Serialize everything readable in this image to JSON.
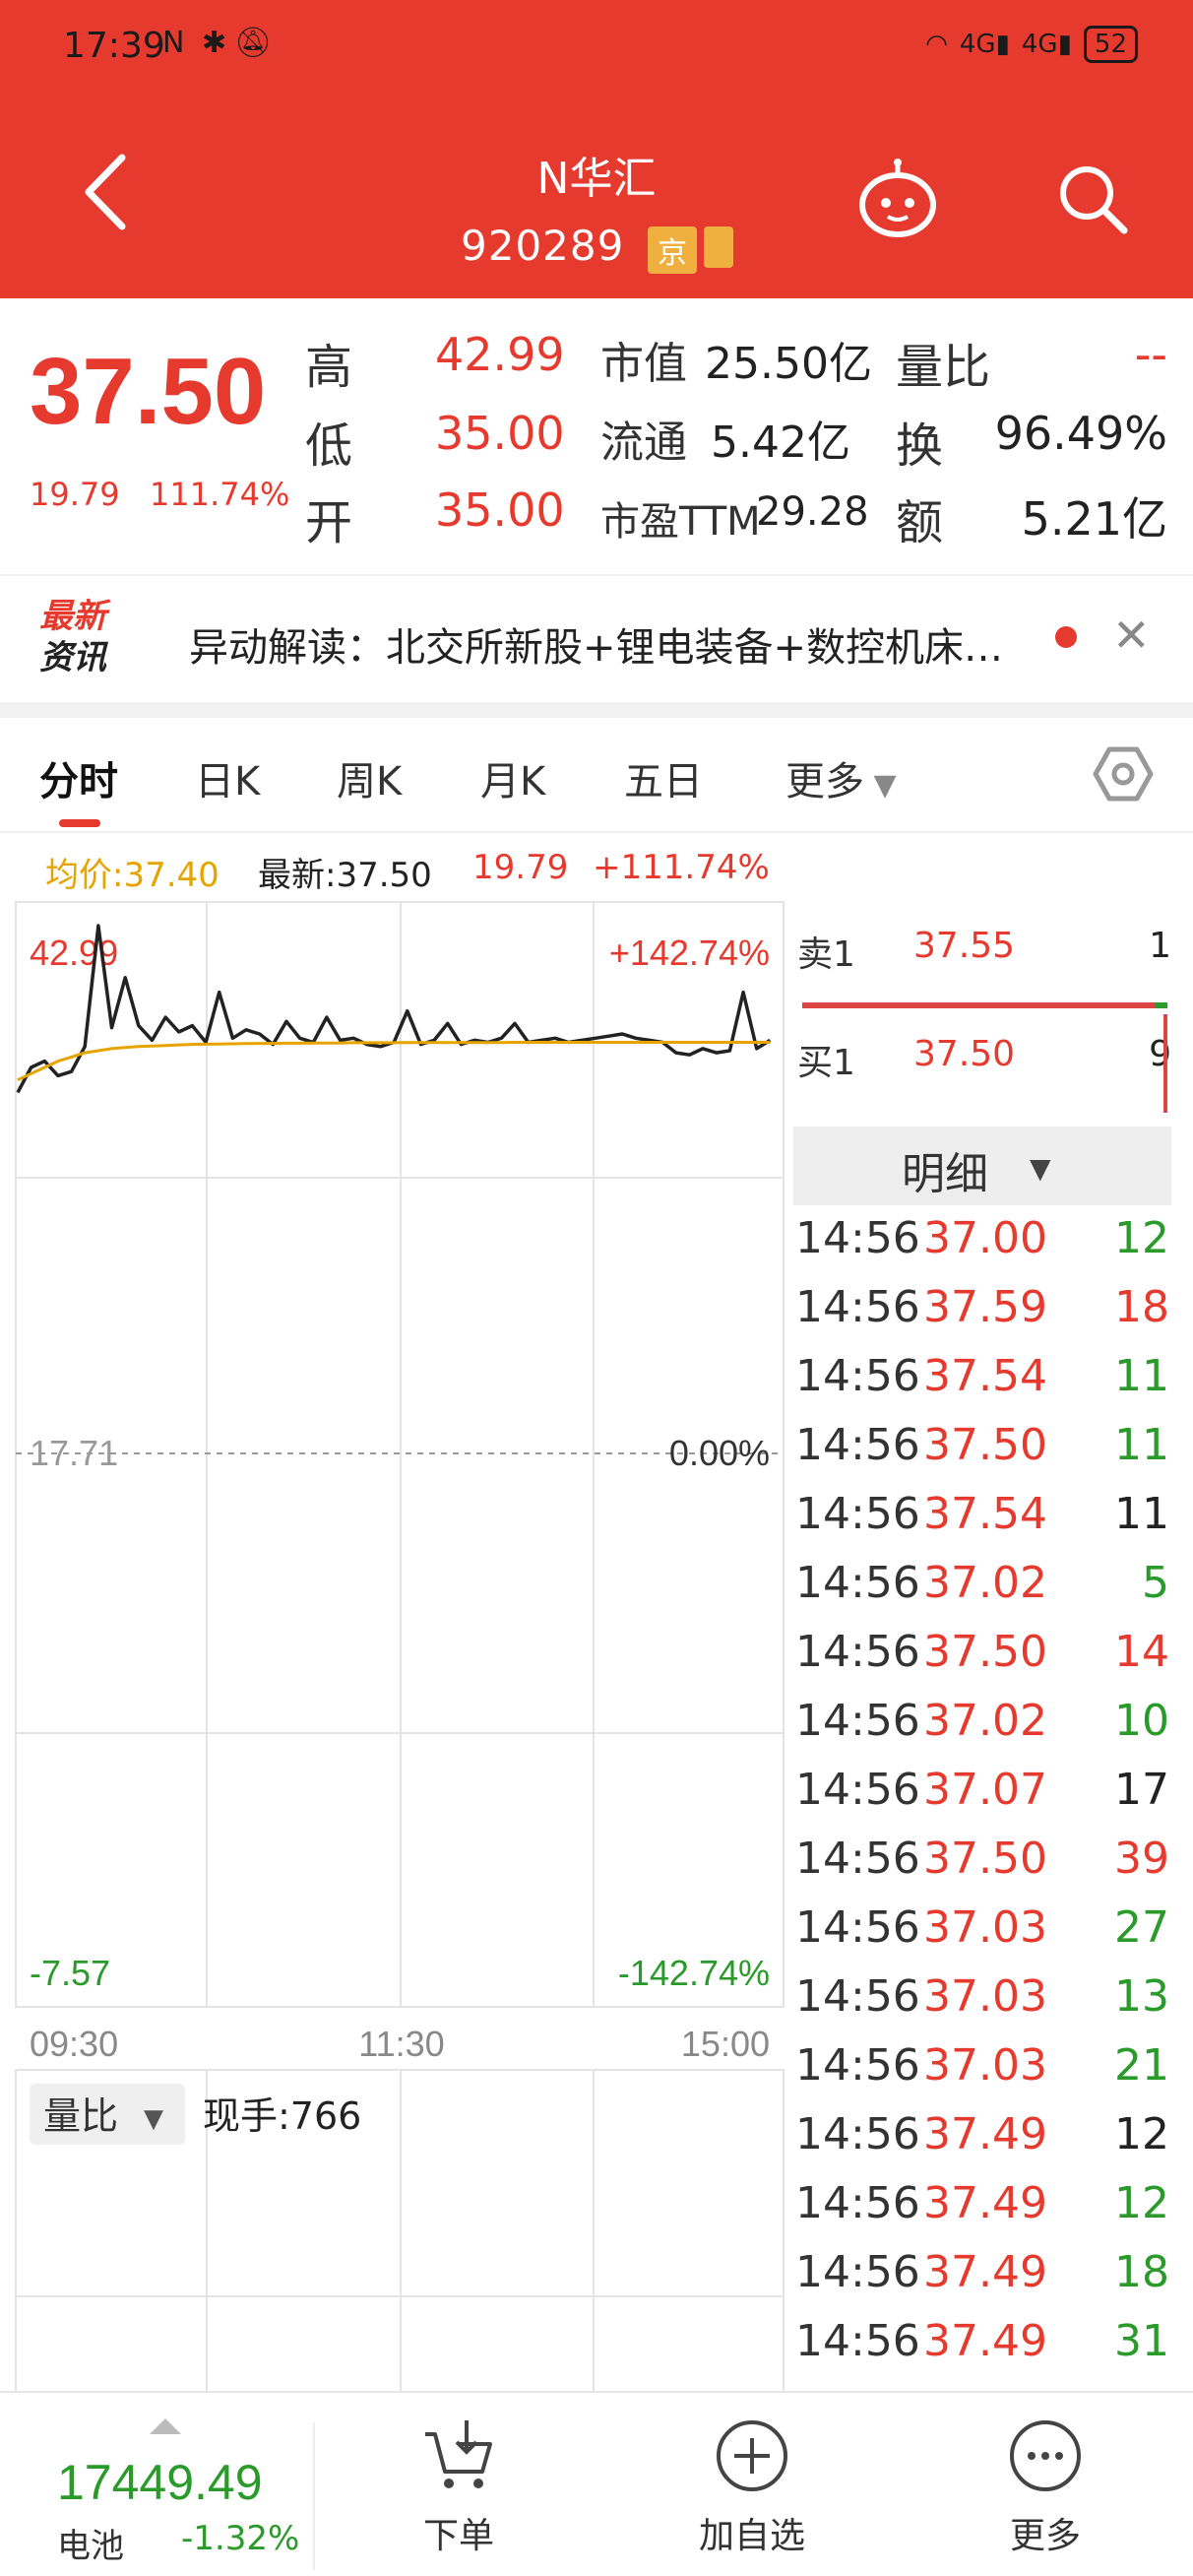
{
  "status_bar": {
    "time": "17:39",
    "network": "4G",
    "network2": "4G",
    "battery": "52"
  },
  "header": {
    "stock_name": "N华汇",
    "stock_code": "920289",
    "market_tag": "京"
  },
  "quote": {
    "price": "37.50",
    "change_abs": "19.79",
    "change_pct": "111.74%",
    "high_label": "高",
    "high": "42.99",
    "low_label": "低",
    "low": "35.00",
    "open_label": "开",
    "open": "35.00",
    "mcap_label": "市值",
    "mcap": "25.50亿",
    "float_label": "流通",
    "float": "5.42亿",
    "pe_label": "市盈TTM",
    "pe": "29.28",
    "vr_label": "量比",
    "vr": "--",
    "turn_label": "换",
    "turn": "96.49%",
    "amt_label": "额",
    "amt": "5.21亿"
  },
  "news": {
    "logo_line1": "最新",
    "logo_line2": "资讯",
    "text": "异动解读：北交所新股+锂电装备+数控机床…"
  },
  "tabs": [
    "分时",
    "日K",
    "周K",
    "月K",
    "五日",
    "更多"
  ],
  "chart_info": {
    "avg_label": "均价:37.40",
    "latest_label": "最新:37.50",
    "chg_abs": "19.79",
    "chg_pct": "+111.74%"
  },
  "chart_data": {
    "type": "line",
    "y_left_ticks": [
      "42.99",
      "17.71",
      "-7.57"
    ],
    "y_right_ticks": [
      "+142.74%",
      "0.00%",
      "-142.74%"
    ],
    "x_ticks": [
      "09:30",
      "11:30",
      "15:00"
    ],
    "series": [
      {
        "name": "最新",
        "color": "#222222",
        "values": [
          35.0,
          36.2,
          36.5,
          35.8,
          36.0,
          37.2,
          42.99,
          38.1,
          40.5,
          38.2,
          37.5,
          38.6,
          37.9,
          38.2,
          37.4,
          39.8,
          37.6,
          38.0,
          37.8,
          37.3,
          38.4,
          37.6,
          37.4,
          38.6,
          37.5,
          37.6,
          37.3,
          37.2,
          37.4,
          38.9,
          37.3,
          37.5,
          38.3,
          37.3,
          37.5,
          37.4,
          37.6,
          38.3,
          37.4,
          37.5,
          37.6,
          37.4,
          37.5,
          37.6,
          37.7,
          37.8,
          37.6,
          37.5,
          37.4,
          36.9,
          36.8,
          37.1,
          36.9,
          37.0,
          39.8,
          37.1,
          37.5
        ]
      },
      {
        "name": "均价",
        "color": "#e6a400",
        "values": [
          35.6,
          35.9,
          36.2,
          36.5,
          36.7,
          36.9,
          37.0,
          37.1,
          37.15,
          37.2,
          37.22,
          37.25,
          37.28,
          37.3,
          37.31,
          37.32,
          37.33,
          37.34,
          37.35,
          37.35,
          37.36,
          37.36,
          37.37,
          37.37,
          37.37,
          37.38,
          37.38,
          37.38,
          37.38,
          37.39,
          37.39,
          37.39,
          37.39,
          37.39,
          37.39,
          37.39,
          37.39,
          37.4,
          37.4,
          37.4,
          37.4,
          37.4,
          37.4,
          37.4,
          37.4,
          37.4,
          37.4,
          37.4,
          37.4,
          37.4,
          37.4,
          37.4,
          37.4,
          37.4,
          37.4,
          37.4,
          37.4
        ]
      }
    ],
    "ylim": [
      -7.57,
      42.99
    ]
  },
  "volume_panel": {
    "selector_label": "量比",
    "current_vol_label": "现手:766"
  },
  "orderbook": {
    "sell1_label": "卖1",
    "sell1_price": "37.55",
    "sell1_vol": "1",
    "buy1_label": "买1",
    "buy1_price": "37.50",
    "buy1_vol": "9",
    "detail_label": "明细"
  },
  "ticks": [
    {
      "time": "14:56",
      "price": "37.00",
      "vol": "12",
      "vol_color": "#2a9a2a"
    },
    {
      "time": "14:56",
      "price": "37.59",
      "vol": "18",
      "vol_color": "#e63a2e"
    },
    {
      "time": "14:56",
      "price": "37.54",
      "vol": "11",
      "vol_color": "#2a9a2a"
    },
    {
      "time": "14:56",
      "price": "37.50",
      "vol": "11",
      "vol_color": "#2a9a2a"
    },
    {
      "time": "14:56",
      "price": "37.54",
      "vol": "11",
      "vol_color": "#222222"
    },
    {
      "time": "14:56",
      "price": "37.02",
      "vol": "5",
      "vol_color": "#2a9a2a"
    },
    {
      "time": "14:56",
      "price": "37.50",
      "vol": "14",
      "vol_color": "#e63a2e"
    },
    {
      "time": "14:56",
      "price": "37.02",
      "vol": "10",
      "vol_color": "#2a9a2a"
    },
    {
      "time": "14:56",
      "price": "37.07",
      "vol": "17",
      "vol_color": "#222222"
    },
    {
      "time": "14:56",
      "price": "37.50",
      "vol": "39",
      "vol_color": "#e63a2e"
    },
    {
      "time": "14:56",
      "price": "37.03",
      "vol": "27",
      "vol_color": "#2a9a2a"
    },
    {
      "time": "14:56",
      "price": "37.03",
      "vol": "13",
      "vol_color": "#2a9a2a"
    },
    {
      "time": "14:56",
      "price": "37.03",
      "vol": "21",
      "vol_color": "#2a9a2a"
    },
    {
      "time": "14:56",
      "price": "37.49",
      "vol": "12",
      "vol_color": "#222222"
    },
    {
      "time": "14:56",
      "price": "37.49",
      "vol": "12",
      "vol_color": "#2a9a2a"
    },
    {
      "time": "14:56",
      "price": "37.49",
      "vol": "18",
      "vol_color": "#2a9a2a"
    },
    {
      "time": "14:56",
      "price": "37.49",
      "vol": "31",
      "vol_color": "#2a9a2a"
    }
  ],
  "bottom_bar": {
    "index_value": "17449.49",
    "index_name": "电池",
    "index_pct": "-1.32%",
    "order_label": "下单",
    "add_watch_label": "加自选",
    "more_label": "更多"
  }
}
